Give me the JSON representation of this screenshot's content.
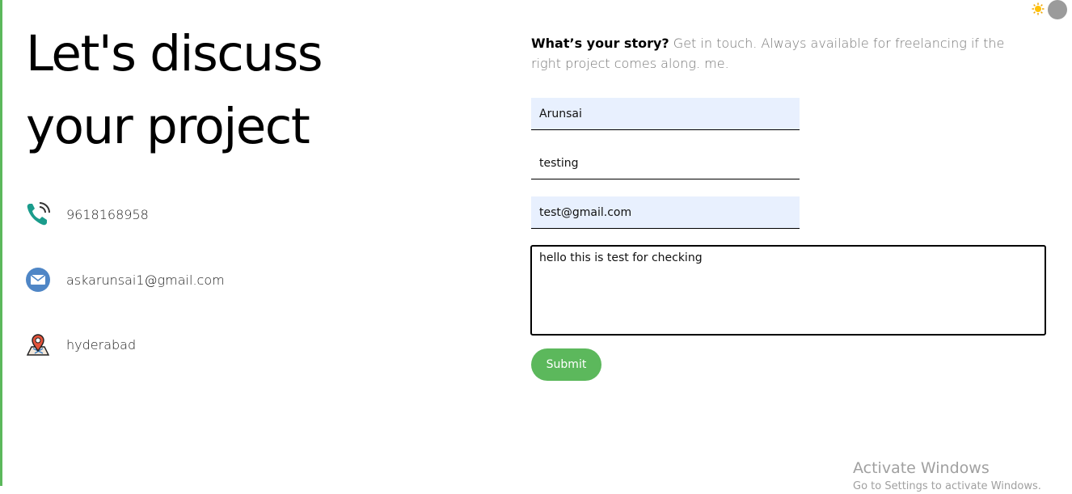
{
  "heading": {
    "line1": "Let's discuss",
    "line2": "your project"
  },
  "contacts": [
    {
      "icon": "phone-icon",
      "text": "9618168958"
    },
    {
      "icon": "mail-icon",
      "text": "askarunsai1@gmail.com"
    },
    {
      "icon": "location-pin-icon",
      "text": "hyderabad"
    }
  ],
  "intro": {
    "bold": "What’s your story?",
    "text": " Get in touch. Always available for freelancing if the right project comes along. me."
  },
  "form": {
    "name_value": "Arunsai",
    "subject_value": "testing",
    "email_value": "test@gmail.com",
    "message_value": "hello this is test for checking ",
    "submit_label": "Submit"
  },
  "theme_toggle": {
    "icon": "sun-icon"
  },
  "watermark": {
    "title": "Activate Windows",
    "subtitle": "Go to Settings to activate Windows."
  },
  "colors": {
    "accent": "#5cb85c",
    "autofill": "#e8f0fe"
  }
}
